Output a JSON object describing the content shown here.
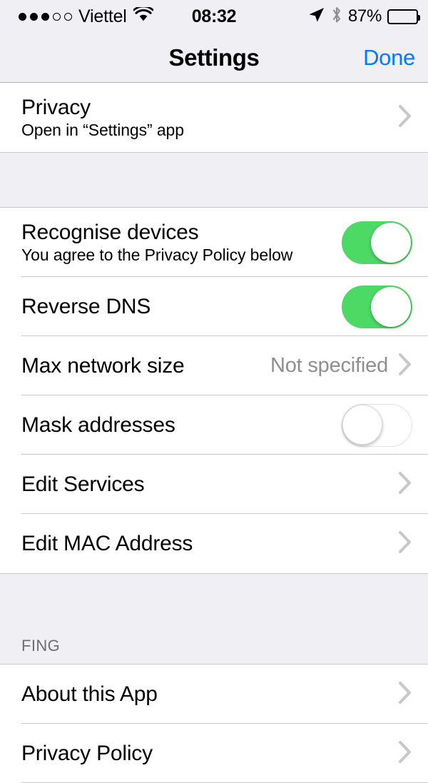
{
  "status_bar": {
    "signal_dots_filled": 3,
    "signal_dots_total": 5,
    "carrier": "Viettel",
    "wifi_icon": "wifi-icon",
    "time": "08:32",
    "location_icon": "location-arrow-icon",
    "bluetooth_icon": "bluetooth-icon",
    "battery_percent": "87%",
    "battery_level": 87
  },
  "nav_bar": {
    "title": "Settings",
    "done_label": "Done"
  },
  "sections": [
    {
      "header": "",
      "rows": [
        {
          "title": "Privacy",
          "subtitle": "Open in “Settings” app",
          "accessory": "chevron"
        }
      ]
    },
    {
      "header": "",
      "rows": [
        {
          "title": "Recognise devices",
          "subtitle": "You agree to the Privacy Policy below",
          "accessory": "toggle",
          "toggle_state": "on"
        },
        {
          "title": "Reverse DNS",
          "subtitle": "",
          "accessory": "toggle",
          "toggle_state": "on"
        },
        {
          "title": "Max network size",
          "subtitle": "",
          "accessory": "chevron",
          "value": "Not specified"
        },
        {
          "title": "Mask addresses",
          "subtitle": "",
          "accessory": "toggle",
          "toggle_state": "off"
        },
        {
          "title": "Edit Services",
          "subtitle": "",
          "accessory": "chevron"
        },
        {
          "title": "Edit MAC Address",
          "subtitle": "",
          "accessory": "chevron"
        }
      ]
    },
    {
      "header": "FING",
      "rows": [
        {
          "title": "About this App",
          "subtitle": "",
          "accessory": "chevron"
        },
        {
          "title": "Privacy Policy",
          "subtitle": "",
          "accessory": "chevron"
        }
      ]
    }
  ],
  "colors": {
    "accent_blue": "#007AFF",
    "toggle_on_green": "#4CD964",
    "group_background": "#EFEFF4",
    "separator": "#C8C7CC",
    "secondary_text": "#8E8E93",
    "header_text": "#6D6D72"
  }
}
